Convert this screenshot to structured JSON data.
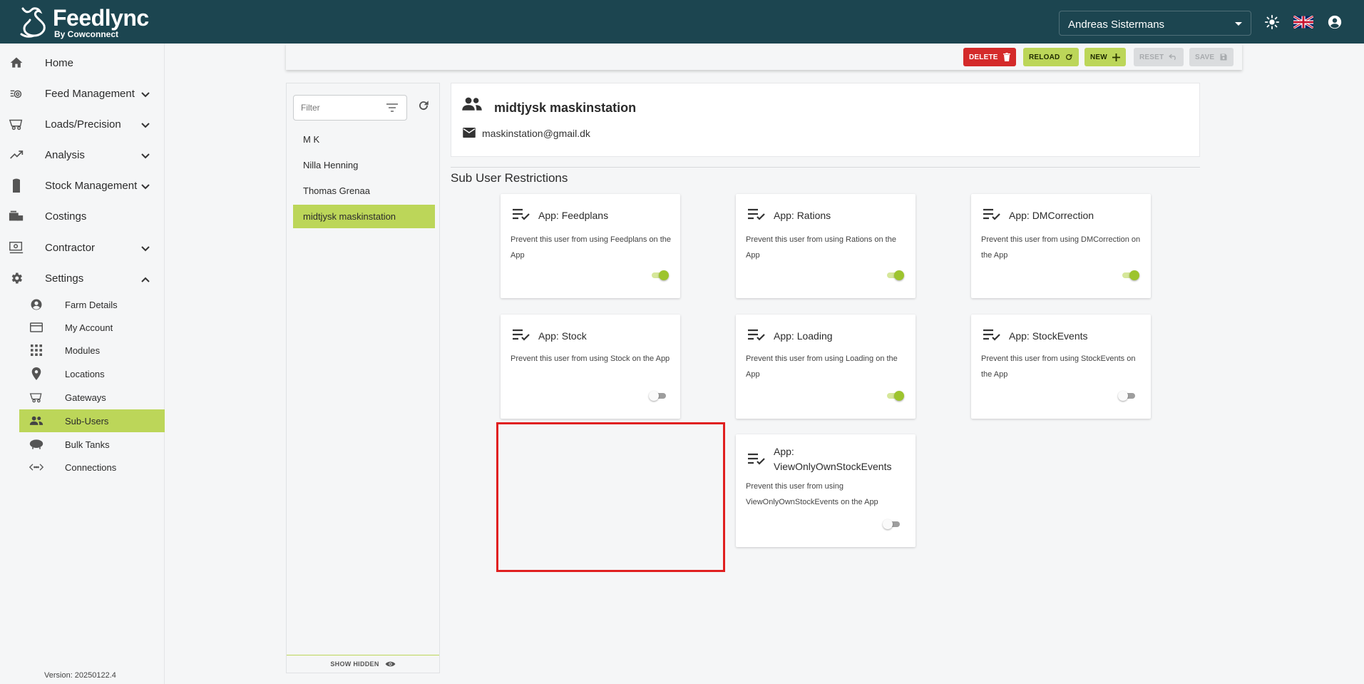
{
  "app": {
    "logo_name": "Feedlync",
    "logo_sub": "By Cowconnect"
  },
  "header": {
    "selected_user": "Andreas Sistermans",
    "icons": [
      "brightness-icon",
      "uk-flag-icon",
      "account-circle-icon"
    ]
  },
  "sidebar": {
    "items": [
      {
        "label": "Home",
        "icon": "home-icon"
      },
      {
        "label": "Feed Management",
        "icon": "feed-management-icon"
      },
      {
        "label": "Loads/Precision",
        "icon": "wagon-icon"
      },
      {
        "label": "Analysis",
        "icon": "trend-icon"
      },
      {
        "label": "Stock Management",
        "icon": "silo-icon"
      },
      {
        "label": "Costings",
        "icon": "costings-icon"
      },
      {
        "label": "Contractor",
        "icon": "contractor-icon"
      },
      {
        "label": "Settings",
        "icon": "gear-icon"
      }
    ],
    "settings_items": [
      {
        "label": "Farm Details",
        "icon": "account-circle-icon"
      },
      {
        "label": "My Account",
        "icon": "credit-card-icon"
      },
      {
        "label": "Modules",
        "icon": "grid-icon"
      },
      {
        "label": "Locations",
        "icon": "location-pin-icon"
      },
      {
        "label": "Gateways",
        "icon": "wagon-icon"
      },
      {
        "label": "Sub-Users",
        "icon": "people-icon"
      },
      {
        "label": "Bulk Tanks",
        "icon": "tank-icon"
      },
      {
        "label": "Connections",
        "icon": "connections-icon"
      }
    ],
    "version": "Version: 20250122.4"
  },
  "toolbar": {
    "delete_label": "DELETE",
    "reload_label": "RELOAD",
    "new_label": "NEW",
    "reset_label": "RESET",
    "save_label": "SAVE"
  },
  "user_list": {
    "filter_placeholder": "Filter",
    "items": [
      "M K",
      "Nilla Henning",
      "Thomas Grenaa",
      "midtjysk maskinstation"
    ],
    "selected_index": 3,
    "show_hidden_label": "SHOW HIDDEN"
  },
  "selected_user": {
    "name": "midtjysk maskinstation",
    "email": "maskinstation@gmail.dk"
  },
  "restrictions": {
    "title": "Sub User Restrictions",
    "cards": [
      {
        "title": "App: Feedplans",
        "description": "Prevent this user from using Feedplans on the App",
        "enabled": true
      },
      {
        "title": "App: Rations",
        "description": "Prevent this user from using Rations on the App",
        "enabled": true
      },
      {
        "title": "App: DMCorrection",
        "description": "Prevent this user from using DMCorrection on the App",
        "enabled": true
      },
      {
        "title": "App: Stock",
        "description": "Prevent this user from using Stock on the App",
        "enabled": false
      },
      {
        "title": "App: Loading",
        "description": "Prevent this user from using Loading on the App",
        "enabled": true
      },
      {
        "title": "App: StockEvents",
        "description": "Prevent this user from using StockEvents on the App",
        "enabled": false
      },
      {
        "title": "App: ViewOnlyOwnStockEvents",
        "description": "Prevent this user from using ViewOnlyOwnStockEvents on the App",
        "enabled": false
      }
    ]
  },
  "colors": {
    "topbar": "#1c4550",
    "accent": "#bcd659",
    "delete": "#d42a2a",
    "toggle_on": "#9dc42e",
    "highlight": "#e02020"
  }
}
